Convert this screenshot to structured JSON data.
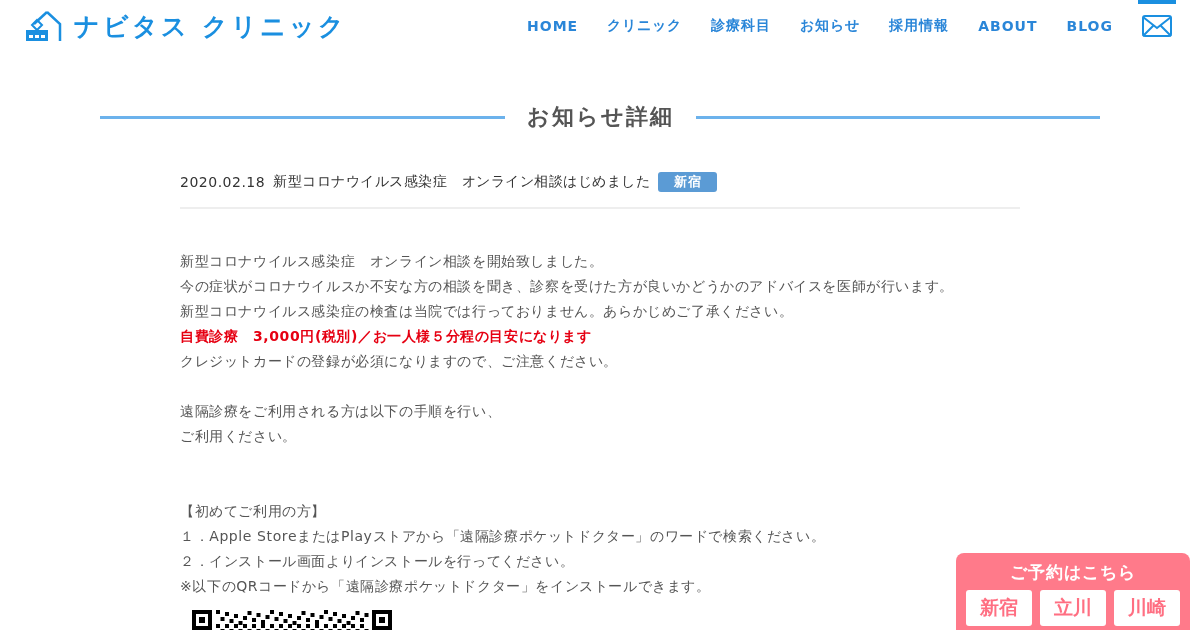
{
  "header": {
    "logo": "ナビタス クリニック",
    "nav": [
      {
        "label": "HOME"
      },
      {
        "label": "クリニック"
      },
      {
        "label": "診療科目"
      },
      {
        "label": "お知らせ"
      },
      {
        "label": "採用情報"
      },
      {
        "label": "ABOUT"
      },
      {
        "label": "BLOG"
      }
    ]
  },
  "page_title": "お知らせ詳細",
  "post": {
    "date": "2020.02.18",
    "title": "新型コロナウイルス感染症　オンライン相談はじめました",
    "tag": "新宿",
    "blocks": [
      {
        "kind": "paragraph",
        "lines": [
          {
            "text": "新型コロナウイルス感染症　オンライン相談を開始致しました。",
            "kind": "plain"
          },
          {
            "text": "今の症状がコロナウイルスか不安な方の相談を聞き、診察を受けた方が良いかどうかのアドバイスを医師が行います。",
            "kind": "plain"
          },
          {
            "text": "新型コロナウイルス感染症の検査は当院では行っておりません。あらかじめご了承ください。",
            "kind": "plain"
          },
          {
            "text": "自費診療　3,000円(税別)／お一人様５分程の目安になります",
            "kind": "alert"
          },
          {
            "text": "クレジットカードの登録が必須になりますので、ご注意ください。",
            "kind": "plain"
          }
        ]
      },
      {
        "kind": "paragraph",
        "lines": [
          {
            "text": "遠隔診療をご利用される方は以下の手順を行い、",
            "kind": "plain"
          },
          {
            "text": "ご利用ください。",
            "kind": "plain"
          }
        ]
      },
      {
        "kind": "section",
        "lines": [
          {
            "text": "【初めてご利用の方】",
            "kind": "plain"
          },
          {
            "text": "１．Apple StoreまたはPlayストアから「遠隔診療ポケットドクター」のワードで検索ください。",
            "kind": "plain"
          },
          {
            "text": "２．インストール画面よりインストールを行ってください。",
            "kind": "plain"
          },
          {
            "text": "※以下のQRコードから「遠隔診療ポケットドクター」をインストールできます。",
            "kind": "plain"
          }
        ]
      }
    ]
  },
  "reservation": {
    "title": "ご予約はこちら",
    "buttons": [
      "新宿",
      "立川",
      "川崎"
    ]
  }
}
